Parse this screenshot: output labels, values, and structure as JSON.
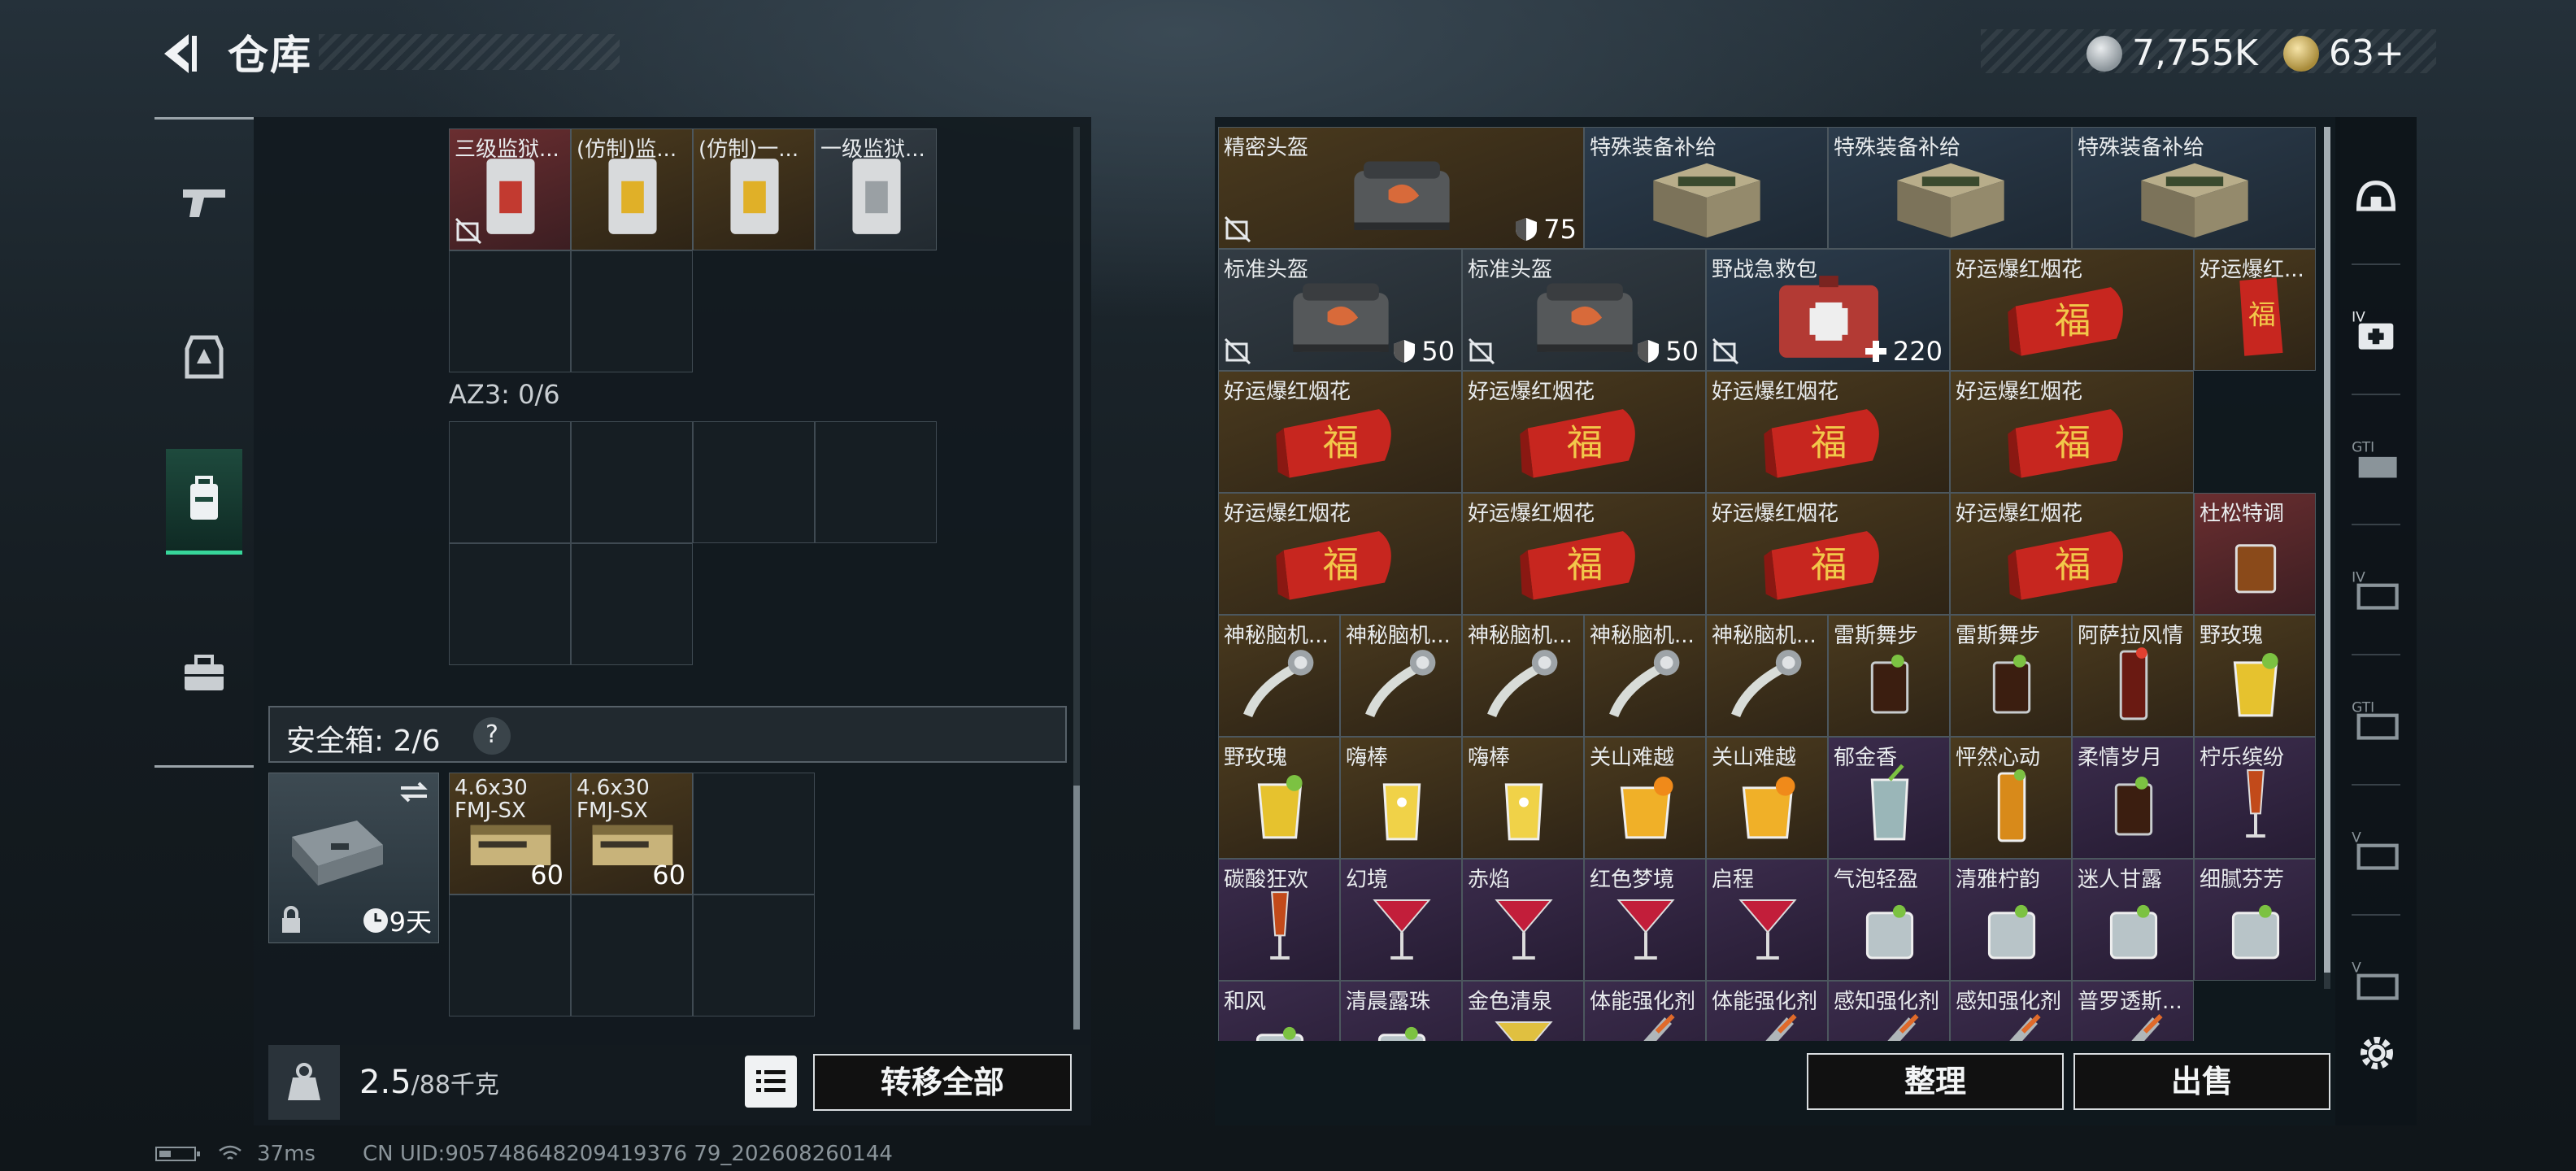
{
  "header": {
    "title": "仓库"
  },
  "currency": {
    "silver": "7,755K",
    "gold": "63+"
  },
  "left_nav": [
    "pistol-icon",
    "armor-icon",
    "backpack-icon",
    "case-icon"
  ],
  "left_panel": {
    "keycards": [
      {
        "label": "三级监狱...",
        "rarity": "red"
      },
      {
        "label": "(仿制)监...",
        "rarity": "gold"
      },
      {
        "label": "(仿制)一...",
        "rarity": "gold"
      },
      {
        "label": "一级监狱...",
        "rarity": "gray"
      }
    ],
    "az3_label": "AZ3: 0/6",
    "safe_box": {
      "label": "安全箱: 2/6",
      "help": "?",
      "days": "9天"
    },
    "ammo": [
      {
        "label": "4.6x30\nFMJ-SX",
        "count": "60"
      },
      {
        "label": "4.6x30\nFMJ-SX",
        "count": "60"
      }
    ],
    "weight": {
      "value": "2.5",
      "unit": "/88千克"
    },
    "transfer_all": "转移全部"
  },
  "right_panel": {
    "items": [
      {
        "label": "精密头盔",
        "rarity": "gold",
        "kind": "bag",
        "value": "75",
        "badge": "shield",
        "nolock": true
      },
      {
        "label": "特殊装备补给",
        "rarity": "blue",
        "kind": "crate"
      },
      {
        "label": "特殊装备补给",
        "rarity": "blue",
        "kind": "crate"
      },
      {
        "label": "特殊装备补给",
        "rarity": "blue",
        "kind": "crate"
      },
      {
        "label": "标准头盔",
        "rarity": "gray",
        "kind": "bag",
        "value": "50",
        "badge": "shield",
        "nolock": true
      },
      {
        "label": "标准头盔",
        "rarity": "gray",
        "kind": "bag",
        "value": "50",
        "badge": "shield",
        "nolock": true
      },
      {
        "label": "野战急救包",
        "rarity": "blue",
        "kind": "medkit",
        "value": "220",
        "badge": "plus",
        "nolock": true
      },
      {
        "label": "好运爆红烟花",
        "rarity": "gold",
        "kind": "firework"
      },
      {
        "label": "好运爆红...",
        "rarity": "gold",
        "kind": "firework-v"
      },
      {
        "label": "好运爆红烟花",
        "rarity": "gold",
        "kind": "firework"
      },
      {
        "label": "好运爆红烟花",
        "rarity": "gold",
        "kind": "firework"
      },
      {
        "label": "好运爆红烟花",
        "rarity": "gold",
        "kind": "firework"
      },
      {
        "label": "好运爆红烟花",
        "rarity": "gold",
        "kind": "firework"
      },
      {
        "label": "好运爆红烟花",
        "rarity": "gold",
        "kind": "firework"
      },
      {
        "label": "好运爆红烟花",
        "rarity": "gold",
        "kind": "firework"
      },
      {
        "label": "好运爆红烟花",
        "rarity": "gold",
        "kind": "firework"
      },
      {
        "label": "好运爆红烟花",
        "rarity": "gold",
        "kind": "firework"
      },
      {
        "label": "杜松特调",
        "rarity": "red",
        "kind": "glass-amber"
      },
      {
        "label": "神秘脑机...",
        "rarity": "gold",
        "kind": "brain"
      },
      {
        "label": "神秘脑机...",
        "rarity": "gold",
        "kind": "brain"
      },
      {
        "label": "神秘脑机...",
        "rarity": "gold",
        "kind": "brain"
      },
      {
        "label": "神秘脑机...",
        "rarity": "gold",
        "kind": "brain"
      },
      {
        "label": "神秘脑机...",
        "rarity": "gold",
        "kind": "brain"
      },
      {
        "label": "雷斯舞步",
        "rarity": "gold",
        "kind": "glass-dark"
      },
      {
        "label": "雷斯舞步",
        "rarity": "gold",
        "kind": "glass-dark"
      },
      {
        "label": "阿萨拉风情",
        "rarity": "gold",
        "kind": "glass-tall-red"
      },
      {
        "label": "野玫瑰",
        "rarity": "gold",
        "kind": "glass-yellow"
      },
      {
        "label": "野玫瑰",
        "rarity": "gold",
        "kind": "glass-yellow"
      },
      {
        "label": "嗨棒",
        "rarity": "gold",
        "kind": "glass-lemon"
      },
      {
        "label": "嗨棒",
        "rarity": "gold",
        "kind": "glass-lemon"
      },
      {
        "label": "关山难越",
        "rarity": "gold",
        "kind": "glass-orange"
      },
      {
        "label": "关山难越",
        "rarity": "gold",
        "kind": "glass-orange"
      },
      {
        "label": "郁金香",
        "rarity": "purple",
        "kind": "glass-clear"
      },
      {
        "label": "怦然心动",
        "rarity": "gold",
        "kind": "glass-tall-orange"
      },
      {
        "label": "柔情岁月",
        "rarity": "purple",
        "kind": "glass-dark"
      },
      {
        "label": "柠乐缤纷",
        "rarity": "purple",
        "kind": "flute"
      },
      {
        "label": "碳酸狂欢",
        "rarity": "purple",
        "kind": "flute"
      },
      {
        "label": "幻境",
        "rarity": "purple",
        "kind": "martini"
      },
      {
        "label": "赤焰",
        "rarity": "purple",
        "kind": "martini"
      },
      {
        "label": "红色梦境",
        "rarity": "purple",
        "kind": "martini"
      },
      {
        "label": "启程",
        "rarity": "purple",
        "kind": "martini"
      },
      {
        "label": "气泡轻盈",
        "rarity": "purple",
        "kind": "rocks"
      },
      {
        "label": "清雅柠韵",
        "rarity": "purple",
        "kind": "rocks"
      },
      {
        "label": "迷人甘露",
        "rarity": "purple",
        "kind": "rocks"
      },
      {
        "label": "细腻芬芳",
        "rarity": "purple",
        "kind": "rocks"
      },
      {
        "label": "和风",
        "rarity": "purple",
        "kind": "rocks"
      },
      {
        "label": "清晨露珠",
        "rarity": "purple",
        "kind": "rocks"
      },
      {
        "label": "金色清泉",
        "rarity": "purple",
        "kind": "martini-gold"
      },
      {
        "label": "体能强化剂",
        "rarity": "purple",
        "kind": "injector"
      },
      {
        "label": "体能强化剂",
        "rarity": "purple",
        "kind": "injector"
      },
      {
        "label": "感知强化剂",
        "rarity": "purple",
        "kind": "injector"
      },
      {
        "label": "感知强化剂",
        "rarity": "purple",
        "kind": "injector"
      },
      {
        "label": "普罗透斯...",
        "rarity": "purple",
        "kind": "injector"
      }
    ],
    "sort": "整理",
    "sell": "出售"
  },
  "right_tabs": [
    "helmet-icon",
    "medkit-IV-icon",
    "ammo-GTI-icon",
    "case-IV-icon",
    "case-GTI-icon",
    "case-V-icon",
    "case-V2-icon"
  ],
  "status": {
    "ping": "37ms",
    "uid": "CN UID:905748648209419376 79_202608260144"
  },
  "colors": {
    "accent": "#37d69a",
    "red": "#6a2e30",
    "gold": "#4a3a1e",
    "purple": "#3b2c4c",
    "blue": "#2c3c4c"
  }
}
